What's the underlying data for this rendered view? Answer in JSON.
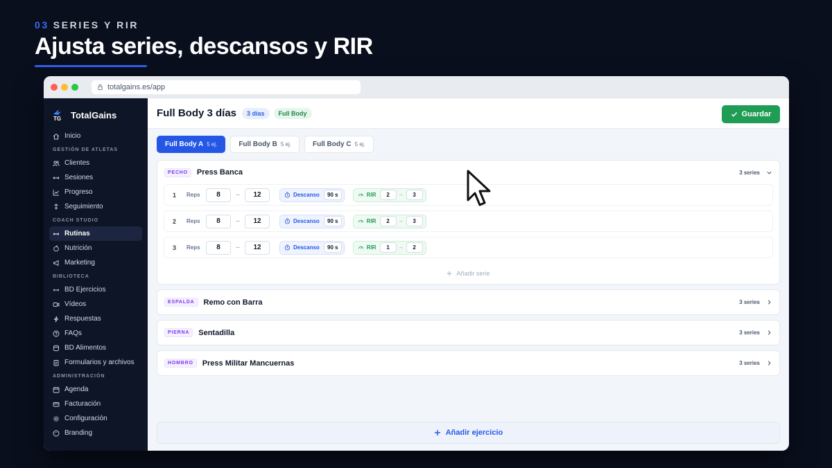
{
  "slide": {
    "step_number": "03",
    "eyebrow": "SERIES Y RIR",
    "headline": "Ajusta series, descansos y RIR"
  },
  "browser": {
    "url": "totalgains.es/app",
    "traffic_lights": [
      "#ff5f57",
      "#febc2e",
      "#28c840"
    ]
  },
  "sidebar": {
    "brand": "TotalGains",
    "home": "Inicio",
    "sections": [
      {
        "title": "GESTIÓN DE ATLETAS",
        "items": [
          "Clientes",
          "Sesiones",
          "Progreso",
          "Seguimiento"
        ]
      },
      {
        "title": "COACH STUDIO",
        "items": [
          "Rutinas",
          "Nutrición",
          "Marketing"
        ]
      },
      {
        "title": "BIBLIOTECA",
        "items": [
          "BD Ejercicios",
          "Vídeos",
          "Respuestas",
          "FAQs",
          "BD Alimentos",
          "Formularios y archivos"
        ]
      },
      {
        "title": "ADMINISTRACIÓN",
        "items": [
          "Agenda",
          "Facturación",
          "Configuración",
          "Branding"
        ]
      }
    ],
    "active_item": "Rutinas"
  },
  "header": {
    "title": "Full Body 3 días",
    "badge_days": "3 días",
    "badge_type": "Full Body",
    "save_label": "Guardar"
  },
  "tabs": [
    {
      "label": "Full Body A",
      "count": "5 ej.",
      "active": true
    },
    {
      "label": "Full Body B",
      "count": "5 ej.",
      "active": false
    },
    {
      "label": "Full Body C",
      "count": "5 ej.",
      "active": false
    }
  ],
  "exercises": [
    {
      "tag": "PECHO",
      "name": "Press Banca",
      "series_label": "3 series",
      "expanded": true,
      "sets": [
        {
          "num": "1",
          "reps_label": "Reps",
          "reps_min": "8",
          "reps_max": "12",
          "rest_label": "Descanso",
          "rest": "90 s",
          "rir_label": "RIR",
          "rir_min": "2",
          "rir_max": "3"
        },
        {
          "num": "2",
          "reps_label": "Reps",
          "reps_min": "8",
          "reps_max": "12",
          "rest_label": "Descanso",
          "rest": "90 s",
          "rir_label": "RIR",
          "rir_min": "2",
          "rir_max": "3"
        },
        {
          "num": "3",
          "reps_label": "Reps",
          "reps_min": "8",
          "reps_max": "12",
          "rest_label": "Descanso",
          "rest": "90 s",
          "rir_label": "RIR",
          "rir_min": "1",
          "rir_max": "2"
        }
      ],
      "add_set_label": "Añadir serie"
    },
    {
      "tag": "ESPALDA",
      "name": "Remo con Barra",
      "series_label": "3 series",
      "expanded": false
    },
    {
      "tag": "PIERNA",
      "name": "Sentadilla",
      "series_label": "3 series",
      "expanded": false
    },
    {
      "tag": "HOMBRO",
      "name": "Press Militar Mancuernas",
      "series_label": "3 series",
      "expanded": false
    }
  ],
  "add_exercise_label": "Añadir ejercicio",
  "range_separator": "–",
  "colors": {
    "accent": "#2557e6",
    "success": "#1f9d55",
    "sidebar_bg": "#0e1527",
    "tag_text": "#7c3aed"
  }
}
